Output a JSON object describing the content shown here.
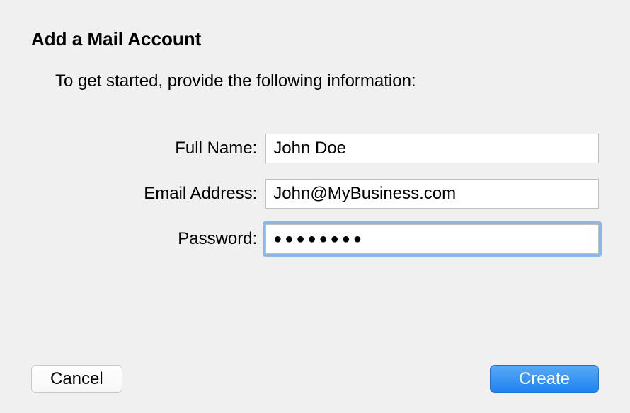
{
  "dialog": {
    "title": "Add a Mail Account",
    "subtitle": "To get started, provide the following information:"
  },
  "form": {
    "fullName": {
      "label": "Full Name:",
      "value": "John Doe"
    },
    "email": {
      "label": "Email Address:",
      "value": "John@MyBusiness.com"
    },
    "password": {
      "label": "Password:",
      "display": "●●●●●●●●"
    }
  },
  "buttons": {
    "cancel": "Cancel",
    "create": "Create"
  }
}
